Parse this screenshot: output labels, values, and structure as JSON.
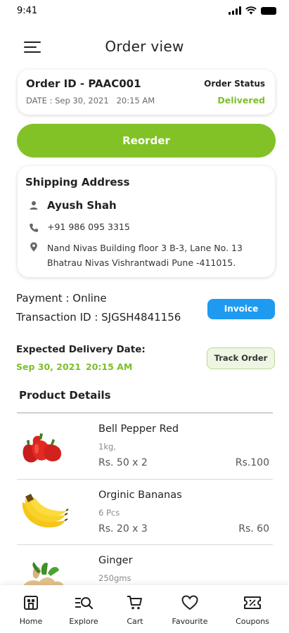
{
  "status_bar": {
    "time": "9:41"
  },
  "header": {
    "title": "Order view"
  },
  "order": {
    "id": "Order ID - PAAC001",
    "date": "DATE : Sep 30, 2021   20:15 AM",
    "status_label": "Order Status",
    "status_value": "Delivered"
  },
  "reorder_label": "Reorder",
  "shipping": {
    "title": "Shipping Address",
    "name": "Ayush Shah",
    "phone": "+91 986 095 3315",
    "address": "Nand Nivas Building floor 3 B-3, Lane No. 13 Bhatrau Nivas Vishrantwadi Pune -411015."
  },
  "payment": {
    "method": "Payment : Online",
    "transaction": "Transaction ID : SJGSH4841156",
    "invoice_label": "Invoice"
  },
  "delivery": {
    "label": "Expected Delivery Date:",
    "date": "Sep 30, 2021",
    "time": "20:15 AM",
    "track_label": "Track Order"
  },
  "products": {
    "title": "Product Details",
    "items": [
      {
        "name": "Bell Pepper Red",
        "qty": "1kg,",
        "price": "Rs. 50 x 2",
        "total": "Rs.100",
        "icon": "bell-pepper-image"
      },
      {
        "name": "Orginic Bananas",
        "qty": "6 Pcs",
        "price": "Rs. 20 x 3",
        "total": "Rs. 60",
        "icon": "bananas-image"
      },
      {
        "name": "Ginger",
        "qty": "250gms",
        "price": "",
        "total": "",
        "icon": "ginger-image"
      }
    ]
  },
  "nav": {
    "items": [
      {
        "label": "Home",
        "icon": "home-icon"
      },
      {
        "label": "Explore",
        "icon": "explore-icon"
      },
      {
        "label": "Cart",
        "icon": "cart-icon"
      },
      {
        "label": "Favourite",
        "icon": "heart-icon"
      },
      {
        "label": "Coupons",
        "icon": "coupon-icon"
      }
    ]
  },
  "colors": {
    "accent_green": "#82c226",
    "status_green": "#7cbf2a",
    "invoice_blue": "#1e9bf0"
  }
}
